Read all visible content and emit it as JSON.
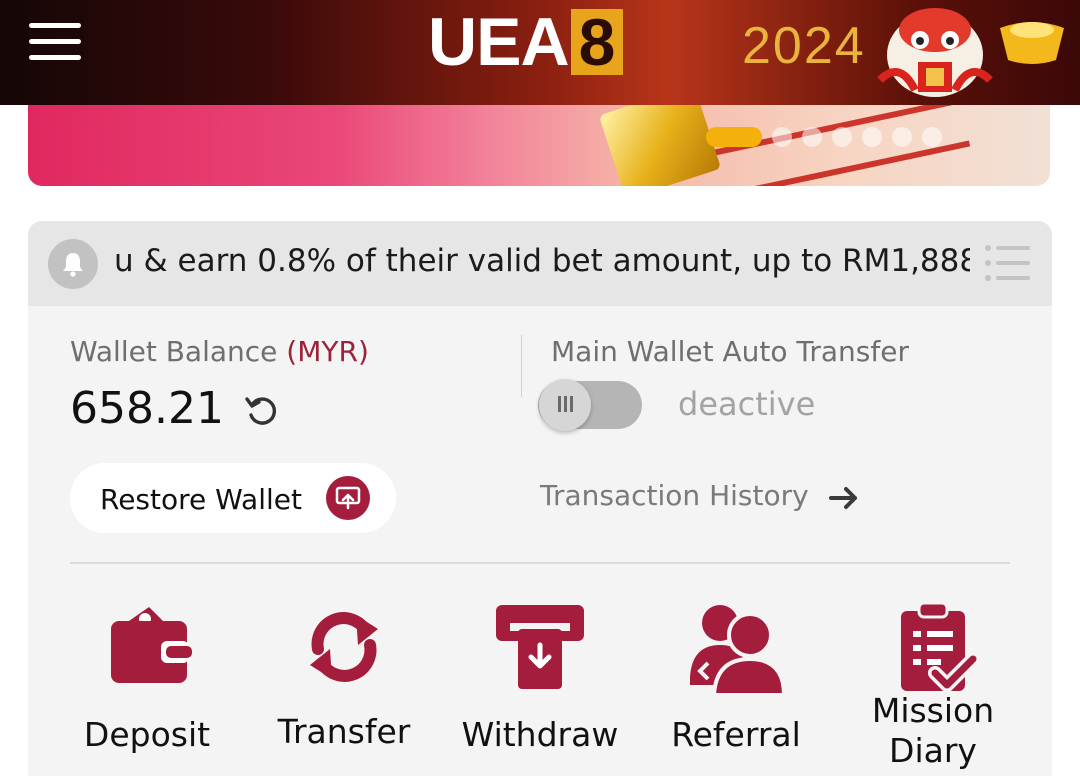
{
  "header": {
    "logo_text": "UEA",
    "logo_number": "8",
    "year_text": "2024"
  },
  "banner": {
    "slide_count": 7,
    "active_slide": 1
  },
  "ticker": {
    "text": "u & earn 0.8% of  their valid bet amount, up to RM1,888"
  },
  "wallet": {
    "label": "Wallet Balance",
    "currency": "(MYR)",
    "balance": "658.21"
  },
  "auto_transfer": {
    "label": "Main Wallet Auto Transfer",
    "state": "deactive"
  },
  "restore": {
    "label": "Restore Wallet"
  },
  "transaction_history": {
    "label": "Transaction History"
  },
  "actions": [
    {
      "label": "Deposit",
      "icon": "wallet-icon"
    },
    {
      "label": "Transfer",
      "icon": "transfer-arrows-icon"
    },
    {
      "label": "Withdraw",
      "icon": "atm-withdraw-icon"
    },
    {
      "label": "Referral",
      "icon": "users-icon"
    },
    {
      "label": "Mission Diary",
      "label_line1": "Mission",
      "label_line2": "Diary",
      "icon": "clipboard-check-icon"
    }
  ],
  "colors": {
    "accent": "#a51d3c",
    "currency": "#9a2239",
    "toggle_off": "#b5b5b5",
    "logo_gold": "#e8a41b"
  }
}
